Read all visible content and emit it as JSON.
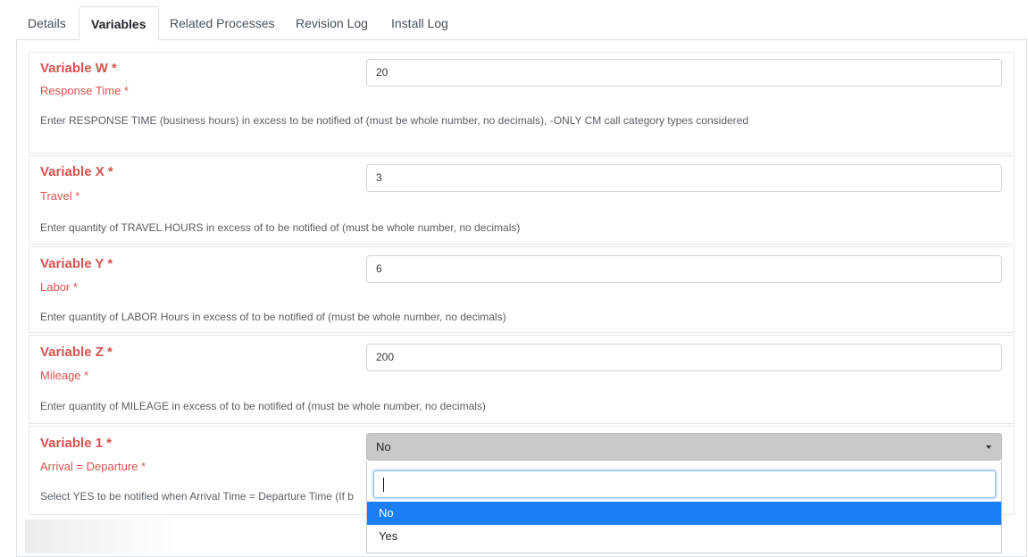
{
  "tabs": [
    {
      "label": "Details"
    },
    {
      "label": "Variables"
    },
    {
      "label": "Related Processes"
    },
    {
      "label": "Revision Log"
    },
    {
      "label": "Install Log"
    }
  ],
  "variables": [
    {
      "name": "Variable W *",
      "label": "Response Time *",
      "value": "20",
      "help": "Enter RESPONSE TIME (business hours) in excess to be notified of (must be whole number, no decimals), -ONLY CM call category types considered"
    },
    {
      "name": "Variable X *",
      "label": "Travel *",
      "value": "3",
      "help": "Enter quantity of TRAVEL HOURS in excess of to be notified of (must be whole number, no decimals)"
    },
    {
      "name": "Variable Y *",
      "label": "Labor *",
      "value": "6",
      "help": "Enter quantity of LABOR Hours in excess of to be notified of (must be whole number, no decimals)"
    },
    {
      "name": "Variable Z *",
      "label": "Mileage *",
      "value": "200",
      "help": "Enter quantity of MILEAGE in excess of to be notified of (must be whole number, no decimals)"
    },
    {
      "name": "Variable 1 *",
      "label": "Arrival = Departure *",
      "value": "No",
      "help": "Select YES to be notified when Arrival Time = Departure Time (If b"
    }
  ],
  "dropdown": {
    "search_value": "",
    "options": [
      "No",
      "Yes"
    ],
    "selected": "No"
  },
  "colors": {
    "required_red": "#d9534f",
    "highlight_blue": "#1a7ff5"
  }
}
